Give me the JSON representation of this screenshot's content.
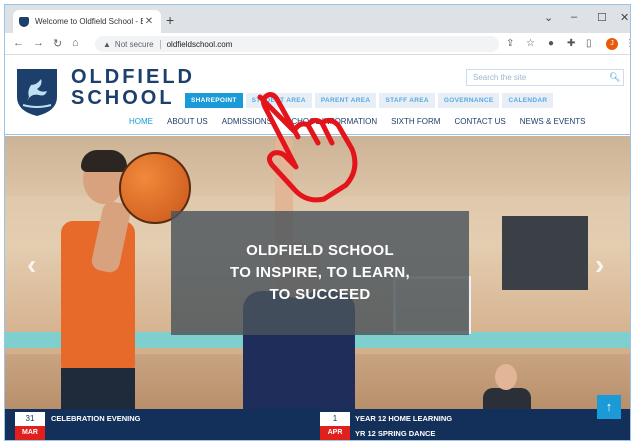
{
  "browser": {
    "tab_title": "Welcome to Oldfield School - Ba",
    "new_tab": "+",
    "minimize": "–",
    "restore": "☐",
    "close": "✕",
    "tab_close": "✕",
    "security_label": "Not secure",
    "url": "oldfieldschool.com",
    "profile_initial": "J",
    "icons": [
      "back-icon",
      "forward-icon",
      "reload-icon",
      "home-icon",
      "share-icon",
      "star-icon",
      "extension-icon",
      "puzzle-icon",
      "sidepanel-icon",
      "menu-icon"
    ]
  },
  "site": {
    "brand_line1": "OLDFIELD",
    "brand_line2": "SCHOOL",
    "search_placeholder": "Search the site",
    "top_links": [
      "SHAREPOINT",
      "STUDENT AREA",
      "PARENT AREA",
      "STAFF AREA",
      "GOVERNANCE",
      "CALENDAR"
    ],
    "nav": [
      "HOME",
      "ABOUT US",
      "ADMISSIONS",
      "SCHOOL INFORMATION",
      "SIXTH FORM",
      "CONTACT US",
      "NEWS & EVENTS"
    ],
    "hero_lines": [
      "OLDFIELD SCHOOL",
      "TO INSPIRE, TO LEARN,",
      "TO SUCCEED"
    ],
    "prev_arrow": "‹",
    "next_arrow": "›",
    "back_to_top": "↑"
  },
  "events": [
    {
      "day": "31",
      "month": "MAR",
      "titles": [
        "CELEBRATION EVENING"
      ]
    },
    {
      "day": "1",
      "month": "APR",
      "titles": [
        "YEAR 12 HOME LEARNING",
        "YR 12 SPRING DANCE"
      ]
    }
  ],
  "colors": {
    "navy": "#1d3f6b",
    "accent_blue": "#1a9ad6",
    "event_red": "#e0201c",
    "cursor_red": "#e3141a"
  }
}
